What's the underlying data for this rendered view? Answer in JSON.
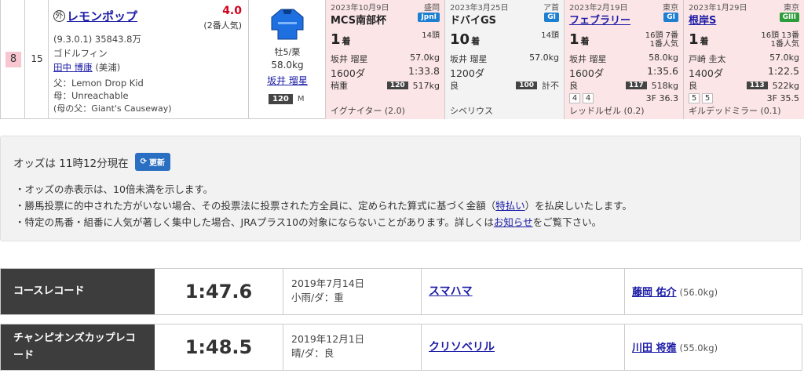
{
  "horse": {
    "waku": "8",
    "umaban": "15",
    "foreign_mark": "外",
    "name": "レモンポップ",
    "odds": "4.0",
    "popularity": "(2番人気)",
    "record": "(9.3.0.1)",
    "earnings": "35843.8万",
    "owner": "ゴドルフィン",
    "trainer_name": "田中 博康",
    "trainer_stable": "(美浦)",
    "sire": "父：Lemon Drop Kid",
    "dam": "母：Unreachable",
    "damsire": "(母の父：Giant's Causeway)",
    "sex_age": "牡5/栗",
    "weight": "58.0kg",
    "jockey": "坂井 瑠星",
    "rating": "120",
    "rating_unit": "M",
    "silk_color": "#1e6fe0"
  },
  "past_runs": [
    {
      "date": "2023年10月9日",
      "venue": "盛岡",
      "race": "MCS南部杯",
      "grade": "JpnI",
      "linked": false,
      "bg": "pink",
      "place": "1",
      "place_unit": "着",
      "heads_top": "14頭",
      "heads_bottom": "",
      "jockey": "坂井 瑠星",
      "load": "57.0kg",
      "distance": "1600ダ",
      "time": "1:33.8",
      "track": "稍重",
      "index": "120",
      "body_weight": "517kg",
      "boxes": [],
      "last3f": "",
      "opponent": "イグナイター (2.0)"
    },
    {
      "date": "2023年3月25日",
      "venue": "ア首",
      "race": "ドバイGS",
      "grade": "GI",
      "linked": false,
      "bg": "grey",
      "place": "10",
      "place_unit": "着",
      "heads_top": "14頭",
      "heads_bottom": "",
      "jockey": "坂井 瑠星",
      "load": "57.0kg",
      "distance": "1200ダ",
      "time": "",
      "track": "良",
      "index": "100",
      "body_weight": "計不",
      "boxes": [],
      "last3f": "",
      "opponent": "シベリウス"
    },
    {
      "date": "2023年2月19日",
      "venue": "東京",
      "race": "フェブラリー",
      "grade": "GI",
      "linked": true,
      "bg": "pink",
      "place": "1",
      "place_unit": "着",
      "heads_top": "16頭 7番",
      "heads_bottom": "1番人気",
      "jockey": "坂井 瑠星",
      "load": "58.0kg",
      "distance": "1600ダ",
      "time": "1:35.6",
      "track": "良",
      "index": "117",
      "body_weight": "518kg",
      "boxes": [
        "4",
        "4"
      ],
      "last3f": "3F 36.3",
      "opponent": "レッドルゼル (0.2)"
    },
    {
      "date": "2023年1月29日",
      "venue": "東京",
      "race": "根岸S",
      "grade": "GIII",
      "linked": true,
      "bg": "pink",
      "place": "1",
      "place_unit": "着",
      "heads_top": "16頭 13番",
      "heads_bottom": "1番人気",
      "jockey": "戸崎 圭太",
      "load": "57.0kg",
      "distance": "1400ダ",
      "time": "1:22.5",
      "track": "良",
      "index": "113",
      "body_weight": "522kg",
      "boxes": [
        "5",
        "5"
      ],
      "last3f": "3F 35.5",
      "opponent": "ギルデッドミラー (0.1)"
    }
  ],
  "notice": {
    "odds_time": "オッズは 11時12分現在",
    "refresh_label": "更新",
    "bullet1": "・オッズの赤表示は、10倍未満を示します。",
    "bullet2_pre": "・勝馬投票に的中された方がいない場合、その投票法に投票された方全員に、定められた算式に基づく金額（",
    "bullet2_link": "特払い",
    "bullet2_post": "）を払戻しいたします。",
    "bullet3_pre": "・特定の馬番・組番に人気が著しく集中した場合、JRAプラス10の対象にならないことがあります。詳しくは",
    "bullet3_link": "お知らせ",
    "bullet3_post": "をご覧下さい。"
  },
  "records": [
    {
      "label": "コースレコード",
      "time": "1:47.6",
      "date": "2019年7月14日",
      "condition": "小雨/ダ：重",
      "horse": "スマハマ",
      "jockey": "藤岡 佑介",
      "weight": "(56.0kg)"
    },
    {
      "label": "チャンピオンズカップレコード",
      "time": "1:48.5",
      "date": "2019年12月1日",
      "condition": "晴/ダ：良",
      "horse": "クリソベリル",
      "jockey": "川田 将雅",
      "weight": "(55.0kg)"
    }
  ]
}
